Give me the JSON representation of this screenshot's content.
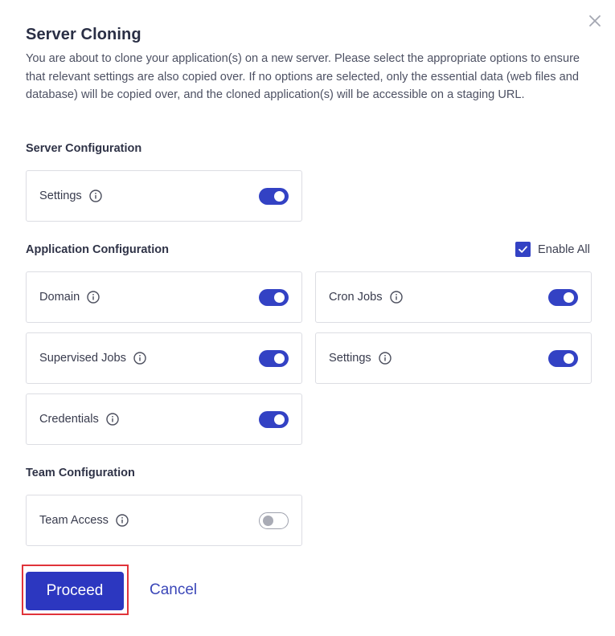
{
  "dialog": {
    "title": "Server Cloning",
    "description": "You are about to clone your application(s) on a new server. Please select the appropriate options to ensure that relevant settings are also copied over. If no options are selected, only the essential data (web files and database) will be copied over, and the cloned application(s) will be accessible on a staging URL."
  },
  "server_config": {
    "heading": "Server Configuration",
    "settings": {
      "label": "Settings",
      "enabled": true
    }
  },
  "app_config": {
    "heading": "Application Configuration",
    "enable_all": {
      "label": "Enable All",
      "checked": true
    },
    "domain": {
      "label": "Domain",
      "enabled": true
    },
    "cron_jobs": {
      "label": "Cron Jobs",
      "enabled": true
    },
    "supervised_jobs": {
      "label": "Supervised Jobs",
      "enabled": true
    },
    "settings": {
      "label": "Settings",
      "enabled": true
    },
    "credentials": {
      "label": "Credentials",
      "enabled": true
    }
  },
  "team_config": {
    "heading": "Team Configuration",
    "team_access": {
      "label": "Team Access",
      "enabled": false
    }
  },
  "actions": {
    "proceed_label": "Proceed",
    "cancel_label": "Cancel"
  },
  "colors": {
    "primary": "#2c37c0",
    "toggle_on": "#3342c4",
    "highlight_outline": "#e0343a"
  }
}
